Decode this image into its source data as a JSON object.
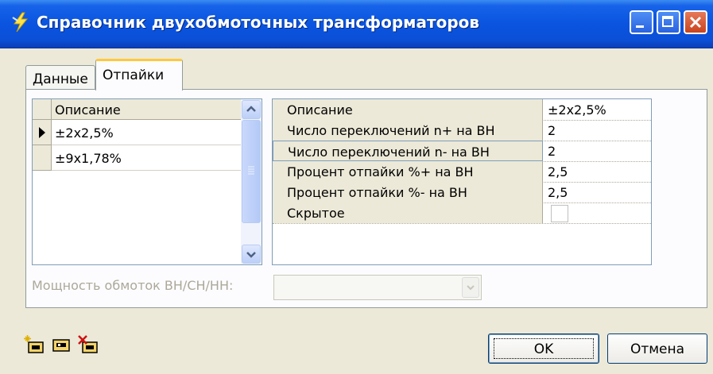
{
  "window": {
    "title": "Справочник двухобмоточных трансформаторов",
    "buttons": {
      "minimize": "minimize-icon",
      "maximize": "maximize-icon",
      "close": "close-icon"
    }
  },
  "tabs": [
    {
      "label": "Данные",
      "selected": false
    },
    {
      "label": "Отпайки",
      "selected": true
    }
  ],
  "taps_grid": {
    "header": "Описание",
    "rows": [
      {
        "value": "±2x2,5%",
        "current": true
      },
      {
        "value": "±9x1,78%",
        "current": false
      }
    ]
  },
  "properties": [
    {
      "name": "Описание",
      "value": "±2x2,5%"
    },
    {
      "name": "Число переключений n+ на ВН",
      "value": "2"
    },
    {
      "name": "Число переключений n- на ВН",
      "value": "2"
    },
    {
      "name": "Процент отпайки %+ на ВН",
      "value": "2,5"
    },
    {
      "name": "Процент отпайки %- на ВН",
      "value": "2,5"
    },
    {
      "name": "Скрытое",
      "value": ""
    }
  ],
  "power": {
    "label": "Мощность обмоток ВН/СН/НН:",
    "value": ""
  },
  "toolbar_icons": [
    "add-record-icon",
    "edit-record-icon",
    "delete-record-icon"
  ],
  "buttons": {
    "ok": "OK",
    "cancel": "Отмена"
  }
}
